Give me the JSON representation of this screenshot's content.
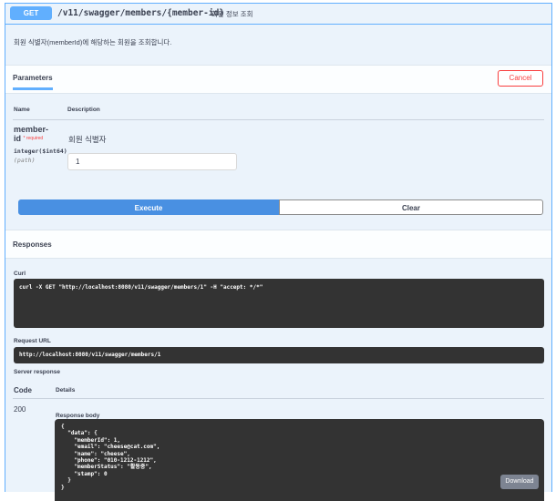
{
  "operation": {
    "method": "GET",
    "path": "/v11/swagger/members/{member-id}",
    "summary": "회원 정보 조회",
    "description": "회원 식별자(memberId)에 해당하는 회원을 조회합니다."
  },
  "parameters": {
    "title": "Parameters",
    "cancel_label": "Cancel",
    "col_name": "Name",
    "col_description": "Description",
    "items": [
      {
        "name": "member-id",
        "required_label": "* required",
        "type": "integer($int64)",
        "in": "(path)",
        "description": "회원 식별자",
        "value": "1"
      }
    ]
  },
  "actions": {
    "execute_label": "Execute",
    "clear_label": "Clear"
  },
  "responses": {
    "title": "Responses",
    "curl_label": "Curl",
    "curl": "curl -X GET \"http://localhost:8080/v11/swagger/members/1\" -H \"accept: */*\"",
    "request_url_label": "Request URL",
    "request_url": "http://localhost:8080/v11/swagger/members/1",
    "server_response_label": "Server response",
    "col_code": "Code",
    "col_details": "Details",
    "status_code": "200",
    "body_label": "Response body",
    "body": "{\n  \"data\": {\n    \"memberId\": 1,\n    \"email\": \"cheese@cat.com\",\n    \"name\": \"cheese\",\n    \"phone\": \"010-1212-1212\",\n    \"memberStatus\": \"활동중\",\n    \"stamp\": 0\n  }\n}",
    "download_label": "Download"
  },
  "colors": {
    "get_accent": "#61affe",
    "execute_blue": "#4990e2",
    "cancel_red": "#f93e3e",
    "code_bg": "#333333"
  }
}
